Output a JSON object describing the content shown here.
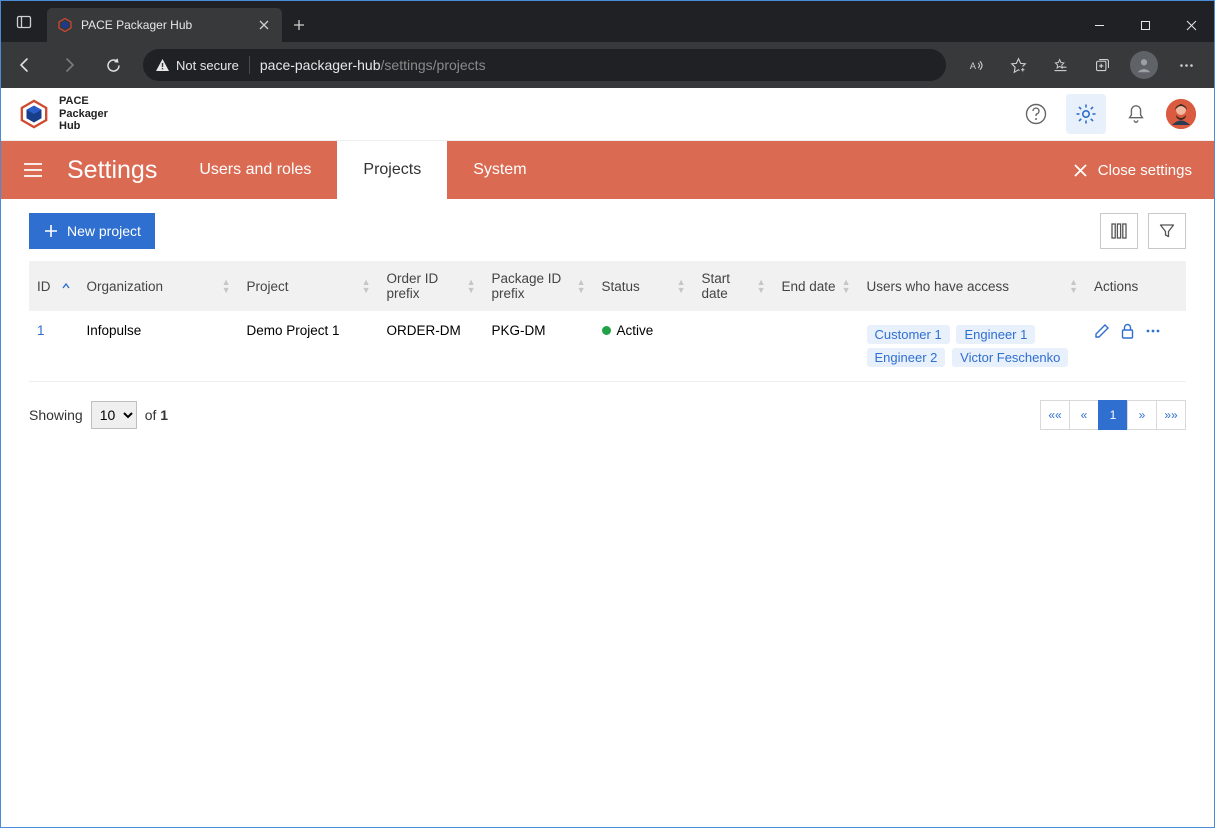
{
  "browser": {
    "tab_title": "PACE Packager Hub",
    "security_label": "Not secure",
    "url_host": "pace-packager-hub",
    "url_path": "/settings/projects"
  },
  "app": {
    "logo_line1": "PACE",
    "logo_line2": "Packager",
    "logo_line3": "Hub"
  },
  "settings": {
    "title": "Settings",
    "tabs": {
      "users": "Users and roles",
      "projects": "Projects",
      "system": "System"
    },
    "close_label": "Close settings"
  },
  "toolbar": {
    "new_project_label": "New project"
  },
  "table": {
    "headers": {
      "id": "ID",
      "organization": "Organization",
      "project": "Project",
      "order_prefix": "Order ID prefix",
      "package_prefix": "Package ID prefix",
      "status": "Status",
      "start_date": "Start date",
      "end_date": "End date",
      "users": "Users who have access",
      "actions": "Actions"
    },
    "rows": [
      {
        "id": "1",
        "organization": "Infopulse",
        "project": "Demo Project 1",
        "order_prefix": "ORDER-DM",
        "package_prefix": "PKG-DM",
        "status": "Active",
        "start_date": "",
        "end_date": "",
        "users": [
          "Customer 1",
          "Engineer 1",
          "Engineer 2",
          "Victor Feschenko"
        ]
      }
    ]
  },
  "footer": {
    "showing_label": "Showing",
    "of_label": "of",
    "total": "1",
    "page_size": "10",
    "pages": {
      "first": "««",
      "prev": "«",
      "current": "1",
      "next": "»",
      "last": "»»"
    }
  }
}
